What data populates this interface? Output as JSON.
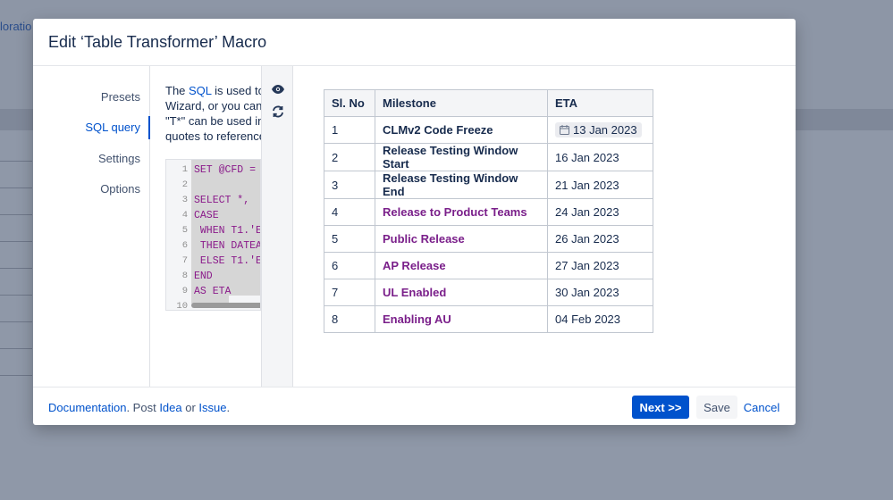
{
  "background": {
    "breadcrumb_fragment": "loratio"
  },
  "dialog": {
    "title": "Edit ‘Table Transformer’ Macro",
    "nav": [
      {
        "label": "Presets",
        "active": false
      },
      {
        "label": "SQL query",
        "active": true
      },
      {
        "label": "Settings",
        "active": false
      },
      {
        "label": "Options",
        "active": false
      }
    ],
    "description": {
      "line1_prefix": "The ",
      "line1_link": "SQL",
      "line1_suffix": " is used to",
      "line2": "Wizard, or you can",
      "line3": "\"T*\" can be used in",
      "line4": "quotes to reference"
    },
    "code": {
      "lines": [
        {
          "n": "1",
          "text": "SET @CFD = "
        },
        {
          "n": "2",
          "text": ""
        },
        {
          "n": "3",
          "text": "SELECT *, "
        },
        {
          "n": "4",
          "text": "CASE"
        },
        {
          "n": "5",
          "text": " WHEN T1.'E"
        },
        {
          "n": "6",
          "text": " THEN DATEA"
        },
        {
          "n": "7",
          "text": " ELSE T1.'E"
        },
        {
          "n": "8",
          "text": "END"
        },
        {
          "n": "9",
          "text": "AS ETA"
        },
        {
          "n": "10",
          "text": ""
        }
      ]
    },
    "tools": {
      "preview_icon": "eye-icon",
      "refresh_icon": "refresh-icon"
    },
    "table": {
      "headers": [
        "Sl. No",
        "Milestone",
        "ETA"
      ],
      "rows": [
        {
          "no": "1",
          "milestone": "CLMv2 Code Freeze",
          "eta": "13 Jan 2023",
          "color": "#172b4d",
          "chip": true
        },
        {
          "no": "2",
          "milestone": "Release Testing Window Start",
          "eta": "16 Jan 2023",
          "color": "#172b4d",
          "chip": false
        },
        {
          "no": "3",
          "milestone": "Release Testing Window End",
          "eta": "21 Jan 2023",
          "color": "#172b4d",
          "chip": false
        },
        {
          "no": "4",
          "milestone": "Release to Product Teams",
          "eta": "24 Jan 2023",
          "color": "#7a1f8a",
          "chip": false
        },
        {
          "no": "5",
          "milestone": "Public Release",
          "eta": "26 Jan 2023",
          "color": "#7a1f8a",
          "chip": false
        },
        {
          "no": "6",
          "milestone": "AP Release",
          "eta": "27 Jan 2023",
          "color": "#7a1f8a",
          "chip": false
        },
        {
          "no": "7",
          "milestone": "UL Enabled",
          "eta": "30 Jan 2023",
          "color": "#7a1f8a",
          "chip": false
        },
        {
          "no": "8",
          "milestone": "Enabling AU",
          "eta": "04 Feb 2023",
          "color": "#7a1f8a",
          "chip": false
        }
      ]
    },
    "footer": {
      "documentation": "Documentation",
      "post_text": ". Post ",
      "idea": "Idea",
      "or_text": " or ",
      "issue": "Issue",
      "end_text": ".",
      "next_label": "Next >>",
      "save_label": "Save",
      "cancel_label": "Cancel"
    }
  }
}
